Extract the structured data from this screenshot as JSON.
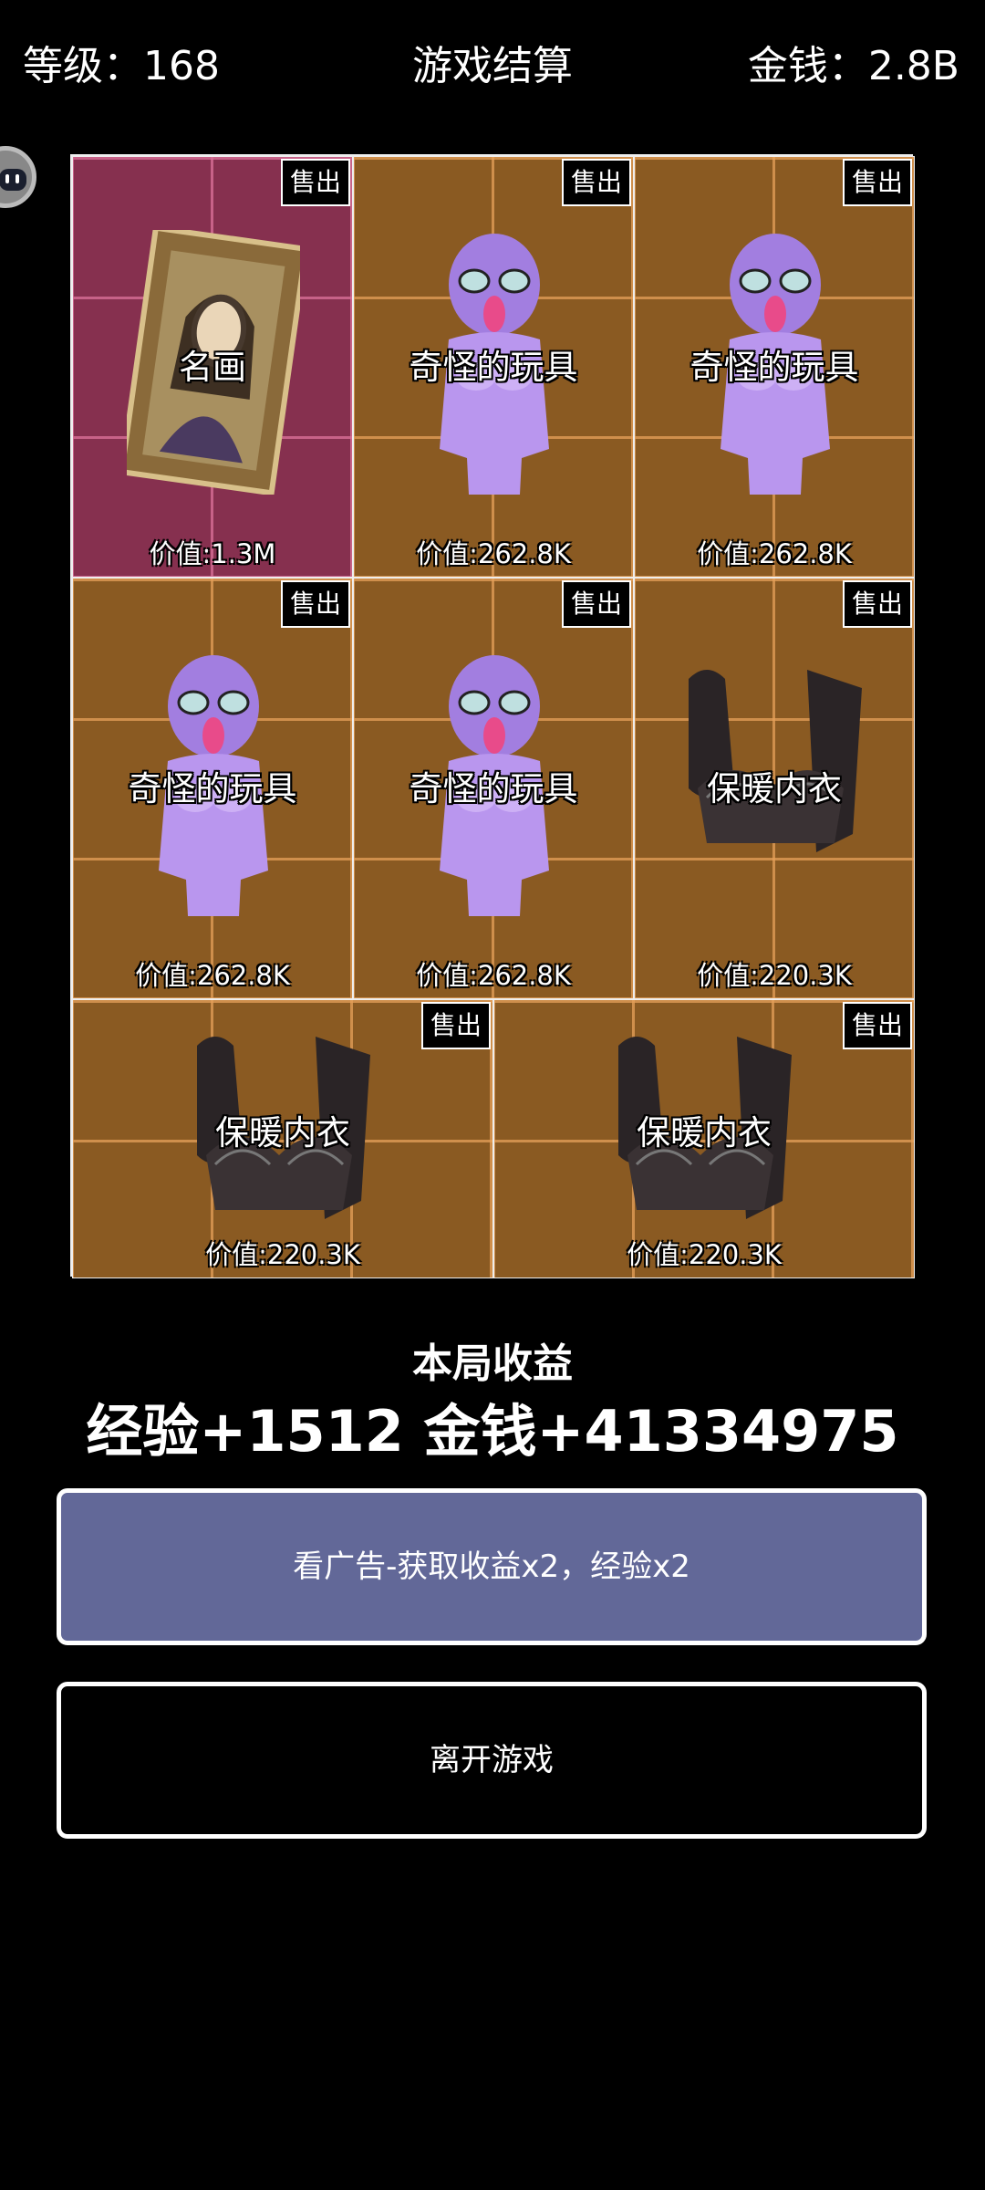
{
  "header": {
    "level": "等级：168",
    "title": "游戏结算",
    "money": "金钱：2.8B"
  },
  "sell_label": "售出",
  "items": [
    {
      "name": "名画",
      "value": "价值:1.3M",
      "kind": "painting",
      "bg": "pink",
      "sellable": true
    },
    {
      "name": "奇怪的玩具",
      "value": "价值:262.8K",
      "kind": "doll",
      "bg": "brown",
      "sellable": true
    },
    {
      "name": "奇怪的玩具",
      "value": "价值:262.8K",
      "kind": "doll",
      "bg": "brown",
      "sellable": true
    },
    {
      "name": "奇怪的玩具",
      "value": "价值:262.8K",
      "kind": "doll",
      "bg": "brown",
      "sellable": true
    },
    {
      "name": "奇怪的玩具",
      "value": "价值:262.8K",
      "kind": "doll",
      "bg": "brown",
      "sellable": true
    },
    {
      "name": "保暖内衣",
      "value": "价值:220.3K",
      "kind": "lingerie",
      "bg": "brown",
      "sellable": true
    },
    {
      "name": "保暖内衣",
      "value": "价值:220.3K",
      "kind": "lingerie",
      "bg": "brown",
      "sellable": true
    },
    {
      "name": "保暖内衣",
      "value": "价值:220.3K",
      "kind": "lingerie",
      "bg": "brown",
      "sellable": true
    }
  ],
  "earnings": {
    "title": "本局收益",
    "values": "经验+1512 金钱+41334975"
  },
  "buttons": {
    "watch_ad": "看广告-获取收益x2，经验x2",
    "leave": "离开游戏"
  },
  "colors": {
    "background": "#000000",
    "cell_brown": "#8a5a22",
    "cell_pink": "#86304f",
    "ad_button": "#626898"
  }
}
